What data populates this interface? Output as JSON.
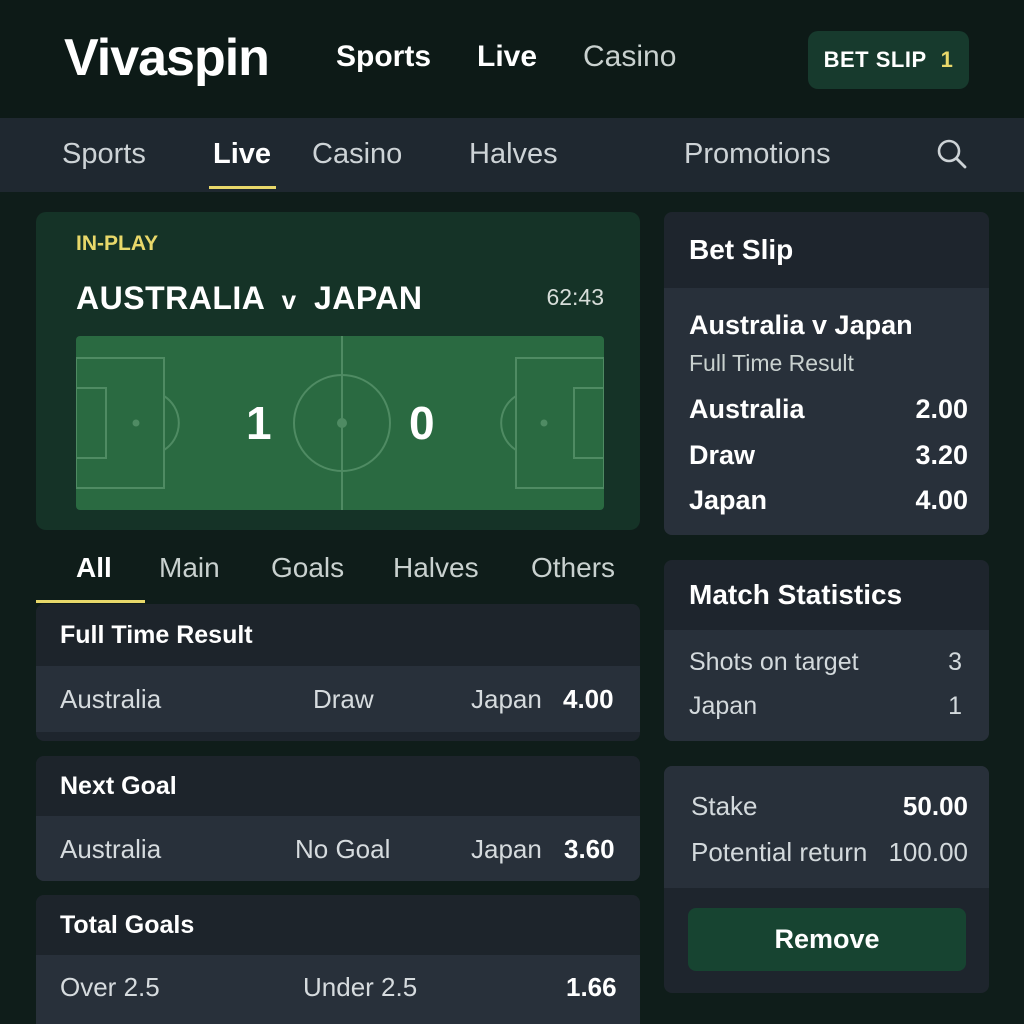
{
  "header": {
    "logo": "Vivaspin",
    "nav": [
      "Sports",
      "Live",
      "Casino"
    ],
    "betslip_label": "BET SLIP",
    "betslip_count": "1"
  },
  "subnav": {
    "items": [
      "Sports",
      "Live",
      "Casino",
      "Halves",
      "Promotions"
    ],
    "active": "Live"
  },
  "inplay": {
    "label": "IN-PLAY",
    "home": "AUSTRALIA",
    "vs": "v",
    "away": "JAPAN",
    "time": "62:43",
    "home_score": "1",
    "away_score": "0"
  },
  "market_tabs": [
    "All",
    "Main",
    "Goals",
    "Halves",
    "Others"
  ],
  "markets": [
    {
      "title": "Full Time Result",
      "home": "Australia",
      "mid": "Draw",
      "away": "Japan",
      "odd": "4.00"
    },
    {
      "title": "Next Goal",
      "home": "Australia",
      "mid": "No Goal",
      "away": "Japan",
      "odd": "3.60"
    },
    {
      "title": "Total Goals",
      "home": "Over 2.5",
      "mid": "Under 2.5",
      "away": "",
      "odd": "1.66"
    }
  ],
  "betslip": {
    "title": "Bet Slip",
    "match": "Australia v Japan",
    "market": "Full Time Result",
    "selections": [
      {
        "name": "Australia",
        "odd": "2.00"
      },
      {
        "name": "Draw",
        "odd": "3.20"
      },
      {
        "name": "Japan",
        "odd": "4.00"
      }
    ]
  },
  "stats": {
    "title": "Match Statistics",
    "rows": [
      {
        "label": "Shots on target",
        "value": "3"
      },
      {
        "label": "Japan",
        "value": "1"
      }
    ]
  },
  "stake": {
    "stake_label": "Stake",
    "stake_value": "50.00",
    "return_label": "Potential return",
    "return_value": "100.00",
    "remove_label": "Remove"
  },
  "colors": {
    "accent": "#e8d86a",
    "background": "#0f1d1a",
    "card": "#1e252d",
    "pitch": "#2a6a41",
    "button": "#174431"
  }
}
